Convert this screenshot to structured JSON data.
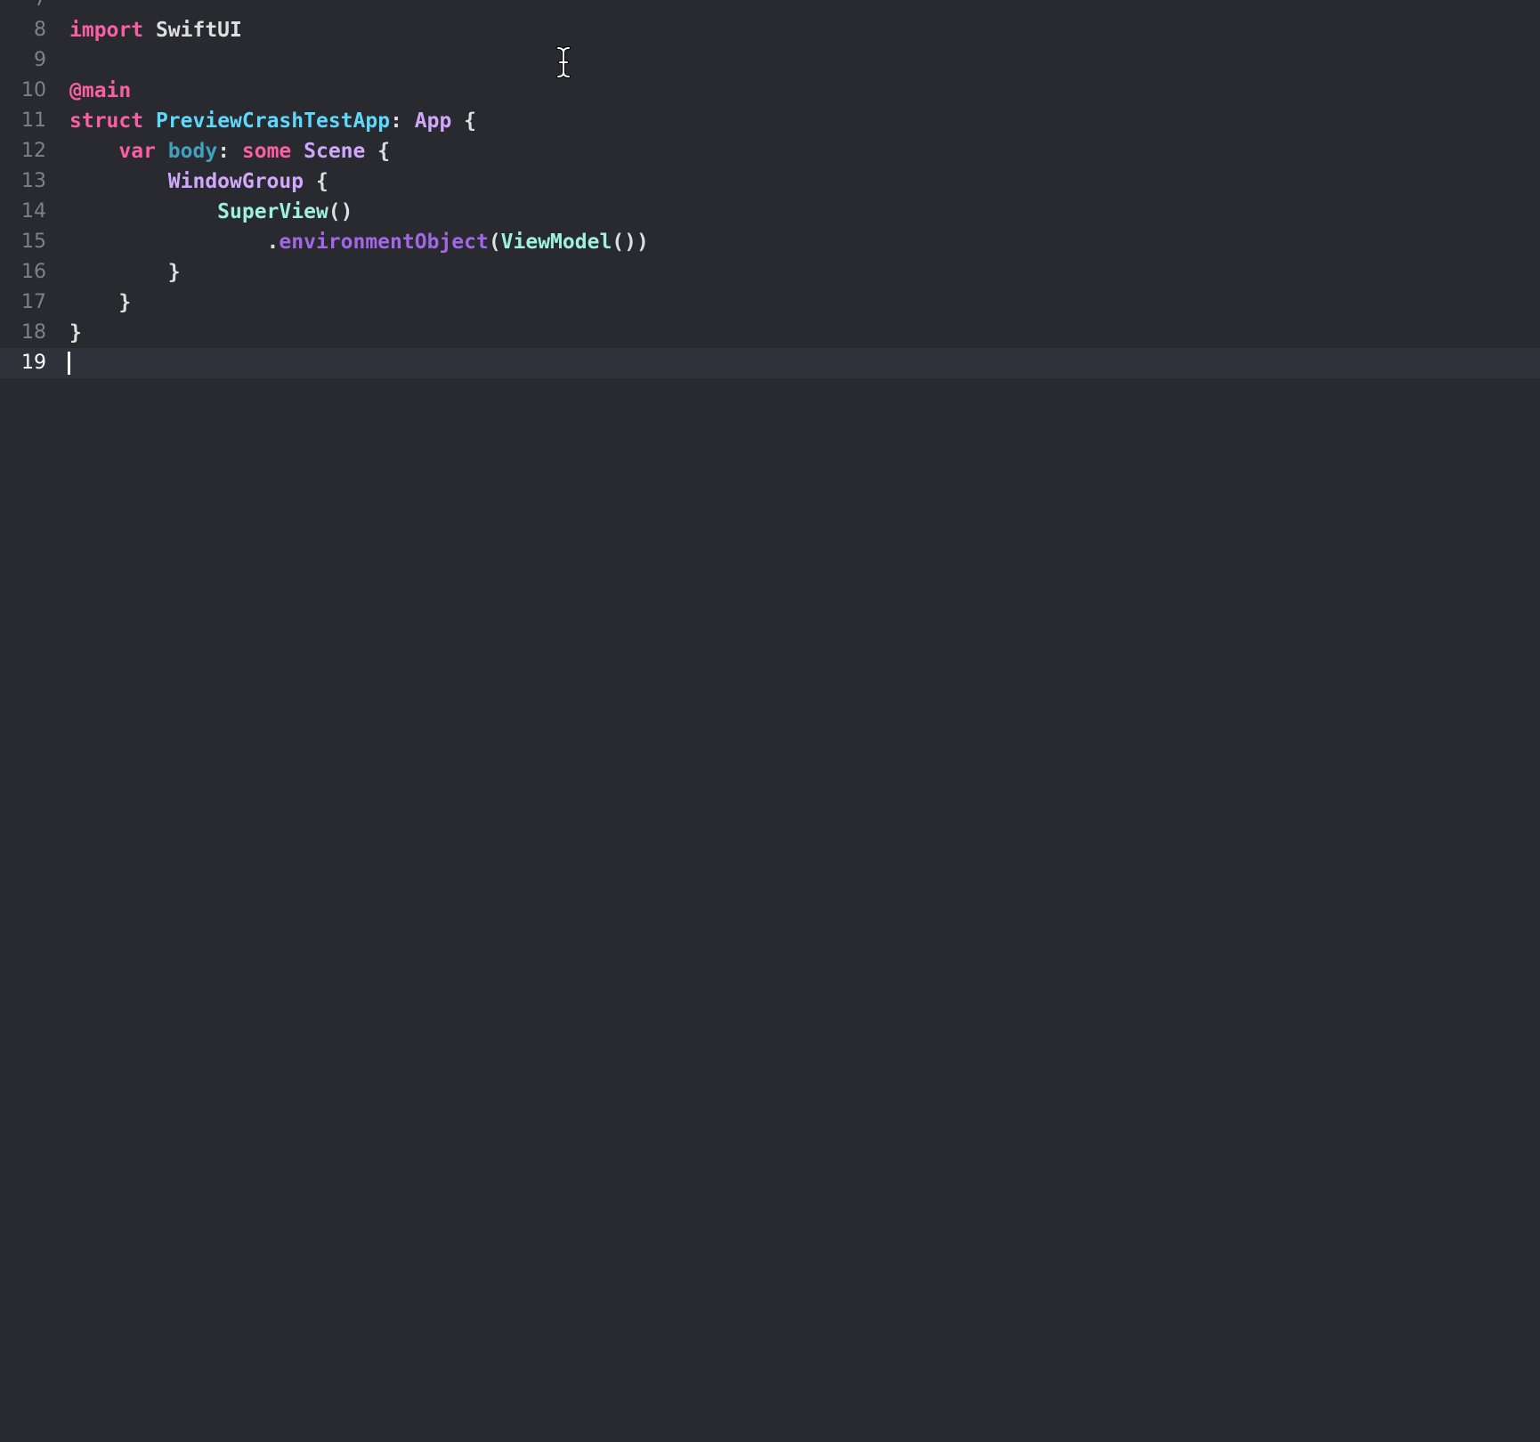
{
  "editor": {
    "partial_line_number": "7",
    "lines": [
      {
        "number": "8",
        "tokens": [
          {
            "text": "import",
            "kind": "kw"
          },
          {
            "text": " SwiftUI",
            "kind": "plain"
          }
        ]
      },
      {
        "number": "9",
        "tokens": []
      },
      {
        "number": "10",
        "tokens": [
          {
            "text": "@main",
            "kind": "kw"
          }
        ]
      },
      {
        "number": "11",
        "tokens": [
          {
            "text": "struct",
            "kind": "kw"
          },
          {
            "text": " ",
            "kind": "plain"
          },
          {
            "text": "PreviewCrashTestApp",
            "kind": "type-decl"
          },
          {
            "text": ": ",
            "kind": "plain"
          },
          {
            "text": "App",
            "kind": "type"
          },
          {
            "text": " {",
            "kind": "plain"
          }
        ]
      },
      {
        "number": "12",
        "tokens": [
          {
            "text": "    ",
            "kind": "plain"
          },
          {
            "text": "var",
            "kind": "kw"
          },
          {
            "text": " ",
            "kind": "plain"
          },
          {
            "text": "body",
            "kind": "prop"
          },
          {
            "text": ": ",
            "kind": "plain"
          },
          {
            "text": "some",
            "kind": "kw"
          },
          {
            "text": " ",
            "kind": "plain"
          },
          {
            "text": "Scene",
            "kind": "type"
          },
          {
            "text": " {",
            "kind": "plain"
          }
        ]
      },
      {
        "number": "13",
        "tokens": [
          {
            "text": "        ",
            "kind": "plain"
          },
          {
            "text": "WindowGroup",
            "kind": "type"
          },
          {
            "text": " {",
            "kind": "plain"
          }
        ]
      },
      {
        "number": "14",
        "tokens": [
          {
            "text": "            ",
            "kind": "plain"
          },
          {
            "text": "SuperView",
            "kind": "proj-type"
          },
          {
            "text": "()",
            "kind": "plain"
          }
        ]
      },
      {
        "number": "15",
        "tokens": [
          {
            "text": "                .",
            "kind": "plain"
          },
          {
            "text": "environmentObject",
            "kind": "method"
          },
          {
            "text": "(",
            "kind": "plain"
          },
          {
            "text": "ViewModel",
            "kind": "proj-type"
          },
          {
            "text": "())",
            "kind": "plain"
          }
        ]
      },
      {
        "number": "16",
        "tokens": [
          {
            "text": "        }",
            "kind": "plain"
          }
        ]
      },
      {
        "number": "17",
        "tokens": [
          {
            "text": "    }",
            "kind": "plain"
          }
        ]
      },
      {
        "number": "18",
        "tokens": [
          {
            "text": "}",
            "kind": "plain"
          }
        ]
      },
      {
        "number": "19",
        "tokens": [],
        "current": true
      }
    ]
  },
  "cursor": {
    "icon": "i-beam-cursor-icon"
  }
}
